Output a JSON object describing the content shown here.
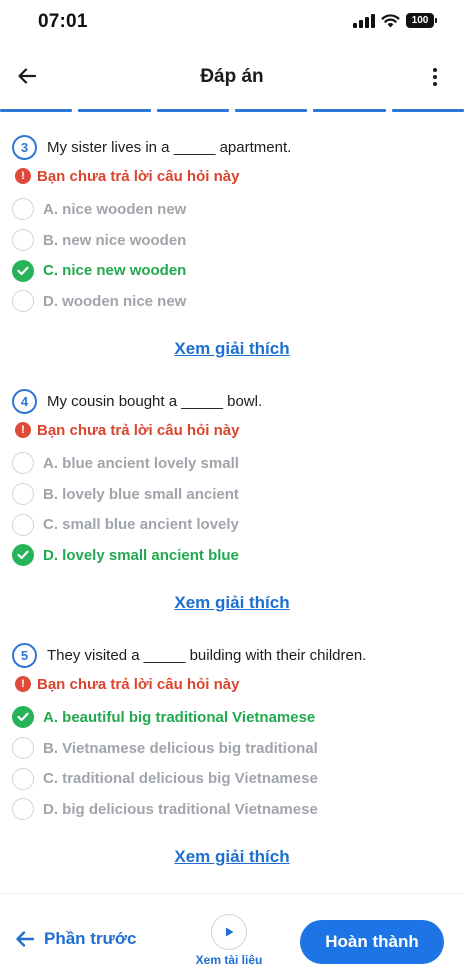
{
  "status_bar": {
    "time": "07:01",
    "battery": "100"
  },
  "header": {
    "title": "Đáp án"
  },
  "questions": [
    {
      "number": "3",
      "text": "My sister lives in a _____ apartment.",
      "warning": "Bạn chưa trả lời câu hỏi này",
      "options": [
        {
          "label": "A. nice wooden new",
          "correct": false
        },
        {
          "label": "B. new nice wooden",
          "correct": false
        },
        {
          "label": "C. nice new wooden",
          "correct": true
        },
        {
          "label": "D. wooden nice new",
          "correct": false
        }
      ],
      "explain_label": "Xem giải thích"
    },
    {
      "number": "4",
      "text": "My cousin bought a _____ bowl.",
      "warning": "Bạn chưa trả lời câu hỏi này",
      "options": [
        {
          "label": "A. blue ancient lovely small",
          "correct": false
        },
        {
          "label": "B. lovely blue small ancient",
          "correct": false
        },
        {
          "label": "C. small blue ancient lovely",
          "correct": false
        },
        {
          "label": "D. lovely small ancient blue",
          "correct": true
        }
      ],
      "explain_label": "Xem giải thích"
    },
    {
      "number": "5",
      "text": "They visited a _____ building with their children.",
      "warning": "Bạn chưa trả lời câu hỏi này",
      "options": [
        {
          "label": "A. beautiful big traditional Vietnamese",
          "correct": true
        },
        {
          "label": "B. Vietnamese delicious big traditional",
          "correct": false
        },
        {
          "label": "C. traditional delicious big Vietnamese",
          "correct": false
        },
        {
          "label": "D. big delicious traditional Vietnamese",
          "correct": false
        }
      ],
      "explain_label": "Xem giải thích"
    }
  ],
  "bottom_bar": {
    "prev_label": "Phần trước",
    "doc_label": "Xem tài liệu",
    "finish_label": "Hoàn thành"
  },
  "colors": {
    "accent": "#1d74e4",
    "correct": "#22a94f",
    "warning": "#d9452f",
    "muted": "#a0a4ab"
  }
}
